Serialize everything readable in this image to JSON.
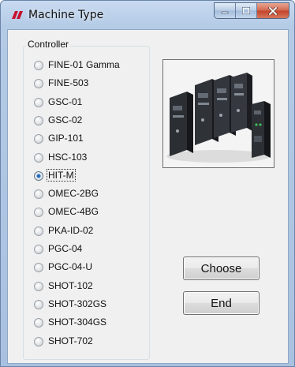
{
  "window": {
    "title": "Machine Type",
    "icon": "app-logo-icon",
    "caption_icons": [
      "minimize-icon",
      "maximize-icon",
      "close-icon"
    ]
  },
  "controller_group": {
    "label": "Controller",
    "selected": "HIT-M",
    "options": [
      "FINE-01 Gamma",
      "FINE-503",
      "GSC-01",
      "GSC-02",
      "GIP-101",
      "HSC-103",
      "HIT-M",
      "OMEC-2BG",
      "OMEC-4BG",
      "PKA-ID-02",
      "PGC-04",
      "PGC-04-U",
      "SHOT-102",
      "SHOT-302GS",
      "SHOT-304GS",
      "SHOT-702"
    ]
  },
  "buttons": {
    "choose_label": "Choose",
    "end_label": "End"
  },
  "colors": {
    "title_bar": "#b4cbe6",
    "close_button": "#c2442a",
    "selected_radio": "#1f5ea8",
    "client_background": "#f0f0f0"
  }
}
